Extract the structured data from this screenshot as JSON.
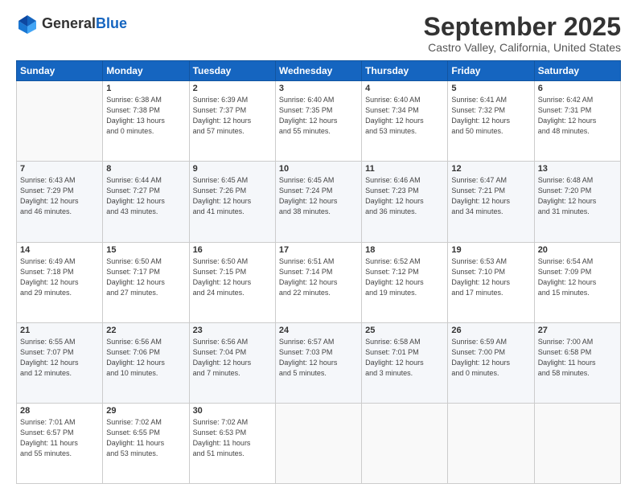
{
  "header": {
    "logo_line1": "General",
    "logo_line2": "Blue",
    "month": "September 2025",
    "location": "Castro Valley, California, United States"
  },
  "weekdays": [
    "Sunday",
    "Monday",
    "Tuesday",
    "Wednesday",
    "Thursday",
    "Friday",
    "Saturday"
  ],
  "weeks": [
    [
      {
        "day": "",
        "info": ""
      },
      {
        "day": "1",
        "info": "Sunrise: 6:38 AM\nSunset: 7:38 PM\nDaylight: 13 hours\nand 0 minutes."
      },
      {
        "day": "2",
        "info": "Sunrise: 6:39 AM\nSunset: 7:37 PM\nDaylight: 12 hours\nand 57 minutes."
      },
      {
        "day": "3",
        "info": "Sunrise: 6:40 AM\nSunset: 7:35 PM\nDaylight: 12 hours\nand 55 minutes."
      },
      {
        "day": "4",
        "info": "Sunrise: 6:40 AM\nSunset: 7:34 PM\nDaylight: 12 hours\nand 53 minutes."
      },
      {
        "day": "5",
        "info": "Sunrise: 6:41 AM\nSunset: 7:32 PM\nDaylight: 12 hours\nand 50 minutes."
      },
      {
        "day": "6",
        "info": "Sunrise: 6:42 AM\nSunset: 7:31 PM\nDaylight: 12 hours\nand 48 minutes."
      }
    ],
    [
      {
        "day": "7",
        "info": "Sunrise: 6:43 AM\nSunset: 7:29 PM\nDaylight: 12 hours\nand 46 minutes."
      },
      {
        "day": "8",
        "info": "Sunrise: 6:44 AM\nSunset: 7:27 PM\nDaylight: 12 hours\nand 43 minutes."
      },
      {
        "day": "9",
        "info": "Sunrise: 6:45 AM\nSunset: 7:26 PM\nDaylight: 12 hours\nand 41 minutes."
      },
      {
        "day": "10",
        "info": "Sunrise: 6:45 AM\nSunset: 7:24 PM\nDaylight: 12 hours\nand 38 minutes."
      },
      {
        "day": "11",
        "info": "Sunrise: 6:46 AM\nSunset: 7:23 PM\nDaylight: 12 hours\nand 36 minutes."
      },
      {
        "day": "12",
        "info": "Sunrise: 6:47 AM\nSunset: 7:21 PM\nDaylight: 12 hours\nand 34 minutes."
      },
      {
        "day": "13",
        "info": "Sunrise: 6:48 AM\nSunset: 7:20 PM\nDaylight: 12 hours\nand 31 minutes."
      }
    ],
    [
      {
        "day": "14",
        "info": "Sunrise: 6:49 AM\nSunset: 7:18 PM\nDaylight: 12 hours\nand 29 minutes."
      },
      {
        "day": "15",
        "info": "Sunrise: 6:50 AM\nSunset: 7:17 PM\nDaylight: 12 hours\nand 27 minutes."
      },
      {
        "day": "16",
        "info": "Sunrise: 6:50 AM\nSunset: 7:15 PM\nDaylight: 12 hours\nand 24 minutes."
      },
      {
        "day": "17",
        "info": "Sunrise: 6:51 AM\nSunset: 7:14 PM\nDaylight: 12 hours\nand 22 minutes."
      },
      {
        "day": "18",
        "info": "Sunrise: 6:52 AM\nSunset: 7:12 PM\nDaylight: 12 hours\nand 19 minutes."
      },
      {
        "day": "19",
        "info": "Sunrise: 6:53 AM\nSunset: 7:10 PM\nDaylight: 12 hours\nand 17 minutes."
      },
      {
        "day": "20",
        "info": "Sunrise: 6:54 AM\nSunset: 7:09 PM\nDaylight: 12 hours\nand 15 minutes."
      }
    ],
    [
      {
        "day": "21",
        "info": "Sunrise: 6:55 AM\nSunset: 7:07 PM\nDaylight: 12 hours\nand 12 minutes."
      },
      {
        "day": "22",
        "info": "Sunrise: 6:56 AM\nSunset: 7:06 PM\nDaylight: 12 hours\nand 10 minutes."
      },
      {
        "day": "23",
        "info": "Sunrise: 6:56 AM\nSunset: 7:04 PM\nDaylight: 12 hours\nand 7 minutes."
      },
      {
        "day": "24",
        "info": "Sunrise: 6:57 AM\nSunset: 7:03 PM\nDaylight: 12 hours\nand 5 minutes."
      },
      {
        "day": "25",
        "info": "Sunrise: 6:58 AM\nSunset: 7:01 PM\nDaylight: 12 hours\nand 3 minutes."
      },
      {
        "day": "26",
        "info": "Sunrise: 6:59 AM\nSunset: 7:00 PM\nDaylight: 12 hours\nand 0 minutes."
      },
      {
        "day": "27",
        "info": "Sunrise: 7:00 AM\nSunset: 6:58 PM\nDaylight: 11 hours\nand 58 minutes."
      }
    ],
    [
      {
        "day": "28",
        "info": "Sunrise: 7:01 AM\nSunset: 6:57 PM\nDaylight: 11 hours\nand 55 minutes."
      },
      {
        "day": "29",
        "info": "Sunrise: 7:02 AM\nSunset: 6:55 PM\nDaylight: 11 hours\nand 53 minutes."
      },
      {
        "day": "30",
        "info": "Sunrise: 7:02 AM\nSunset: 6:53 PM\nDaylight: 11 hours\nand 51 minutes."
      },
      {
        "day": "",
        "info": ""
      },
      {
        "day": "",
        "info": ""
      },
      {
        "day": "",
        "info": ""
      },
      {
        "day": "",
        "info": ""
      }
    ]
  ]
}
